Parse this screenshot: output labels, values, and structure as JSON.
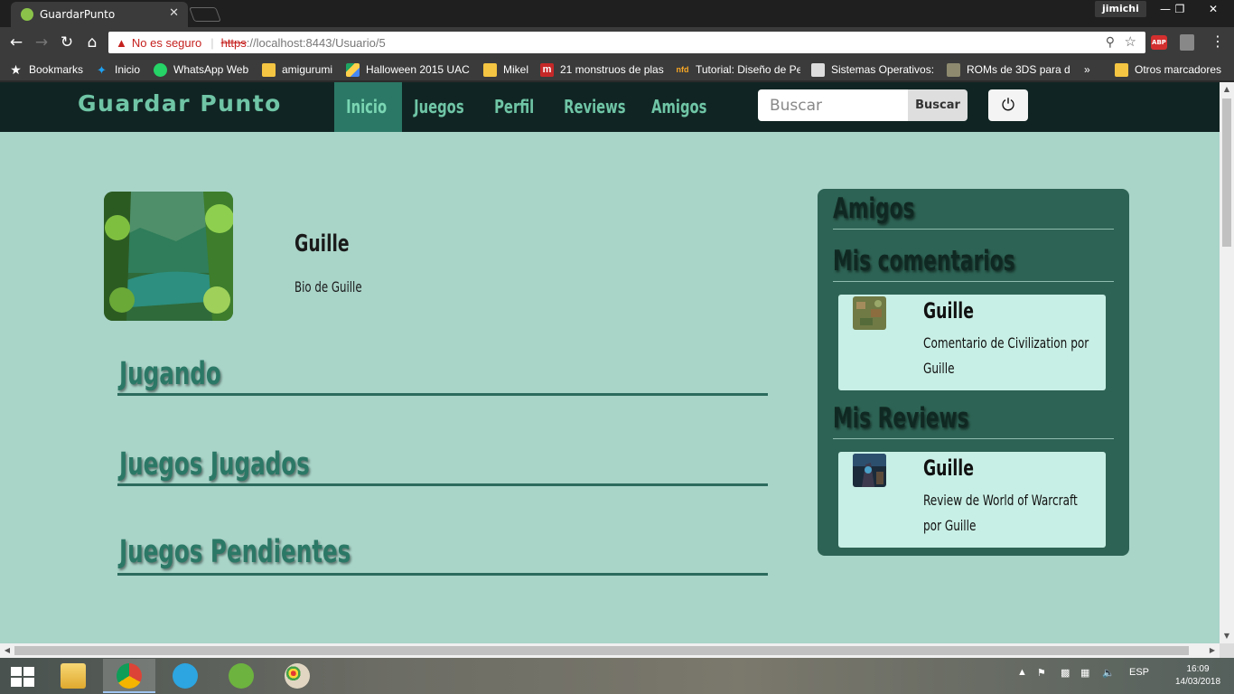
{
  "browser": {
    "tab_title": "GuardarPunto",
    "tab_close": "✕",
    "profile_name": "jimichi",
    "security_label": "No es seguro",
    "url_protocol": "https",
    "url_rest": "://localhost:8443/Usuario/5",
    "bookmarks": [
      {
        "label": "Bookmarks",
        "icon": "star-icon"
      },
      {
        "label": "Inicio",
        "icon": "twitter-icon"
      },
      {
        "label": "WhatsApp Web",
        "icon": "whatsapp-icon"
      },
      {
        "label": "amigurumi",
        "icon": "folder-icon"
      },
      {
        "label": "Halloween 2015 UAC",
        "icon": "drive-icon"
      },
      {
        "label": "Mikel",
        "icon": "folder-icon"
      },
      {
        "label": "21 monstruos de plas",
        "icon": "site-icon"
      },
      {
        "label": "Tutorial: Diseño de Pe",
        "icon": "site-icon"
      },
      {
        "label": "Sistemas Operativos:",
        "icon": "site-icon"
      },
      {
        "label": "ROMs de 3DS para d",
        "icon": "site-icon"
      },
      {
        "label": "Otros marcadores",
        "icon": "folder-icon"
      }
    ],
    "bookmarks_overflow": "»"
  },
  "site": {
    "brand": "Guardar Punto",
    "nav": [
      {
        "label": "Inicio",
        "active": true
      },
      {
        "label": "Juegos",
        "active": false
      },
      {
        "label": "Perfil",
        "active": false
      },
      {
        "label": "Reviews",
        "active": false
      },
      {
        "label": "Amigos",
        "active": false
      }
    ],
    "search_placeholder": "Buscar",
    "search_button": "Buscar",
    "logout_icon": "⏻"
  },
  "profile": {
    "name": "Guille",
    "bio": "Bio de Guille"
  },
  "sections": [
    {
      "title": "Jugando"
    },
    {
      "title": "Juegos Jugados"
    },
    {
      "title": "Juegos Pendientes"
    }
  ],
  "sidebar": {
    "friends_heading": "Amigos",
    "comments_heading": "Mis comentarios",
    "reviews_heading": "Mis Reviews",
    "comments": [
      {
        "author": "Guille",
        "text": "Comentario de Civilization por Guille"
      }
    ],
    "reviews": [
      {
        "author": "Guille",
        "text": "Review de World of Warcraft por Guille"
      }
    ]
  },
  "taskbar": {
    "language": "ESP",
    "time": "16:09",
    "date": "14/03/2018"
  },
  "colors": {
    "page_bg": "#a9d4c8",
    "navbar_bg": "#102523",
    "accent": "#2b7866",
    "panel_bg": "#2d6354",
    "card_bg": "#c8efe5"
  }
}
